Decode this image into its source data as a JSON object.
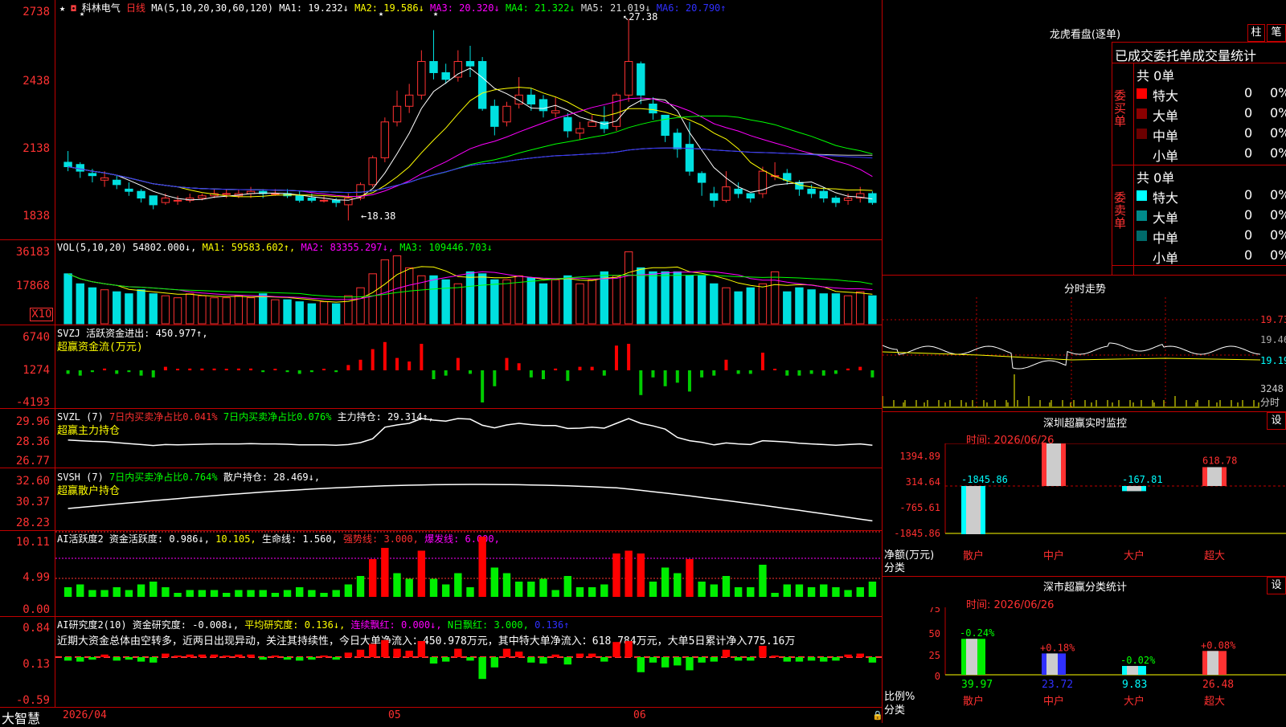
{
  "header": {
    "title": "科林电气",
    "period": "日线",
    "ma_title": "MA(5,10,20,30,60,120)",
    "ma": [
      {
        "label": "MA1: 19.232↓",
        "color": "#ffffff"
      },
      {
        "label": "MA2: 19.586↓",
        "color": "#ffff00"
      },
      {
        "label": "MA3: 20.320↓",
        "color": "#ff00ff"
      },
      {
        "label": "MA4: 21.322↓",
        "color": "#00ff00"
      },
      {
        "label": "MA5: 21.019↓",
        "color": "#dddddd"
      },
      {
        "label": "MA6: 20.790↑",
        "color": "#3030ff"
      }
    ]
  },
  "price_axis": [
    "2738",
    "2438",
    "2138",
    "1838"
  ],
  "price_annotations": {
    "high": "27.38",
    "low": "←18.38"
  },
  "vol": {
    "title": "VOL(5,10,20)",
    "value": "54802.000↓,",
    "ma": [
      {
        "label": "MA1: 59583.602↑,",
        "color": "#ffff00"
      },
      {
        "label": "MA2: 83355.297↓,",
        "color": "#ff00ff"
      },
      {
        "label": "MA3: 109446.703↓",
        "color": "#00ff00"
      }
    ],
    "axis": [
      "36183",
      "17868"
    ],
    "unit": "X10"
  },
  "svzj": {
    "title": "SVZJ  活跃资金进出: 450.977↑,",
    "subtitle": "超赢资金流(万元)",
    "axis": [
      "6740",
      "1274",
      "-4193"
    ]
  },
  "svzl": {
    "title": "SVZL (7)",
    "part1": "7日内买卖净占比0.041%",
    "part2": "7日内买卖净占比0.076%",
    "part3": "主力持仓: 29.314↑,",
    "subtitle": "超赢主力持仓",
    "axis": [
      "29.96",
      "28.36",
      "26.77"
    ]
  },
  "svsh": {
    "title": "SVSH (7)",
    "part1": "7日内买卖净占比0.764%",
    "part2": "散户持仓: 28.469↓,",
    "subtitle": "超赢散户持仓",
    "axis": [
      "32.60",
      "30.37",
      "28.23"
    ]
  },
  "ai1": {
    "title": "AI活跃度2 资金活跃度: 0.986↓,",
    "p1": "10.105,",
    "p2": "生命线: 1.560,",
    "p3": "强势线: 3.000,",
    "p4": "爆发线: 6.000,",
    "axis": [
      "10.11",
      "4.99",
      "0.00"
    ]
  },
  "ai2": {
    "title": "AI研究度2(10) 资金研究度: -0.008↓,",
    "p1": "平均研究度: 0.136↓,",
    "p2": "连续飘红: 0.000↓,",
    "p3": "N日飘红: 3.000,",
    "p4": "0.136↑",
    "text": "近期大资金总体由空转多，近两日出现异动，关注其持续性，今日大单净流入：450.978万元，其中特大单净流入：618.784万元，大单5日累计净入775.16万",
    "axis": [
      "0.84",
      "0.13",
      "-0.59"
    ]
  },
  "bottom": {
    "brand": "大智慧",
    "date_start": "2026/04",
    "m1": "05",
    "m2": "06"
  },
  "right": {
    "lhb_title": "龙虎看盘(逐单)",
    "btn_zhu": "柱",
    "btn_bi": "笔",
    "tabs_title": "已成交委托单成交量统计",
    "buy": {
      "label": "委买单",
      "total": "共 0单",
      "rows": [
        {
          "name": "特大",
          "v": "0",
          "p": "0%",
          "color": "#ff0000"
        },
        {
          "name": "大单",
          "v": "0",
          "p": "0%",
          "color": "#8b0000"
        },
        {
          "name": "中单",
          "v": "0",
          "p": "0%",
          "color": "#6b0000"
        },
        {
          "name": "小单",
          "v": "0",
          "p": "0%",
          "color": "#000000"
        }
      ]
    },
    "sell": {
      "label": "委卖单",
      "total": "共 0单",
      "rows": [
        {
          "name": "特大",
          "v": "0",
          "p": "0%",
          "color": "#00ffff"
        },
        {
          "name": "大单",
          "v": "0",
          "p": "0%",
          "color": "#008b8b"
        },
        {
          "name": "中单",
          "v": "0",
          "p": "0%",
          "color": "#006b6b"
        },
        {
          "name": "小单",
          "v": "0",
          "p": "0%",
          "color": "#000000"
        }
      ]
    },
    "intraday_title": "分时走势",
    "intraday_axis": [
      "19.73",
      "19.46",
      "19.19",
      "3248",
      "分时"
    ],
    "sz_title": "深圳超赢实时监控",
    "sz_btn": "设",
    "sz_time": "时间: 2026/06/26",
    "sz_axis": [
      "1394.89",
      "314.64",
      "-765.61",
      "-1845.86"
    ],
    "sz_ylabel": "净额(万元)",
    "sz_xlabel": "分类",
    "sz_values": [
      "-1845.86",
      "1394.89",
      "-167.81",
      "618.78"
    ],
    "cats": [
      "散户",
      "中户",
      "大户",
      "超大"
    ],
    "ss_title": "深市超赢分类统计",
    "ss_btn": "设",
    "ss_time": "时间: 2026/06/26",
    "ss_axis": [
      "75",
      "50",
      "25",
      "0"
    ],
    "ss_ylabel": "比例%",
    "ss_xlabel": "分类",
    "ss_top": [
      "-0.24%",
      "+0.18%",
      "-0.02%",
      "+0.08%"
    ],
    "ss_bottom": [
      "39.97",
      "23.72",
      "9.83",
      "26.48"
    ]
  },
  "chart_data": {
    "type": "candlestick",
    "price_range": [
      18.2,
      27.6
    ],
    "candles": [
      [
        21.0,
        20.8,
        21.5,
        20.6
      ],
      [
        20.9,
        20.6,
        21.0,
        20.3
      ],
      [
        20.5,
        20.4,
        20.7,
        20.1
      ],
      [
        20.2,
        20.3,
        20.6,
        19.9
      ],
      [
        20.2,
        20.0,
        20.4,
        19.8
      ],
      [
        19.8,
        19.7,
        20.1,
        19.5
      ],
      [
        19.7,
        19.4,
        19.8,
        19.2
      ],
      [
        19.5,
        19.1,
        19.5,
        18.9
      ],
      [
        19.2,
        19.4,
        19.6,
        19.1
      ],
      [
        19.3,
        19.3,
        19.5,
        19.1
      ],
      [
        19.3,
        19.4,
        19.6,
        19.2
      ],
      [
        19.4,
        19.5,
        19.6,
        19.3
      ],
      [
        19.5,
        19.6,
        19.8,
        19.4
      ],
      [
        19.6,
        19.6,
        19.8,
        19.4
      ],
      [
        19.5,
        19.6,
        19.8,
        19.4
      ],
      [
        19.6,
        19.7,
        19.9,
        19.4
      ],
      [
        19.7,
        19.6,
        19.8,
        19.4
      ],
      [
        19.6,
        19.6,
        19.8,
        19.5
      ],
      [
        19.6,
        19.5,
        19.8,
        19.4
      ],
      [
        19.5,
        19.3,
        19.7,
        19.2
      ],
      [
        19.4,
        19.3,
        19.6,
        19.2
      ],
      [
        19.3,
        19.3,
        19.5,
        19.2
      ],
      [
        19.3,
        19.2,
        19.4,
        19.0
      ],
      [
        19.1,
        19.4,
        19.6,
        18.4
      ],
      [
        19.4,
        20.0,
        20.1,
        19.3
      ],
      [
        20.0,
        21.2,
        21.3,
        19.9
      ],
      [
        21.2,
        22.8,
        23.0,
        21.0
      ],
      [
        22.8,
        23.5,
        24.2,
        22.6
      ],
      [
        23.5,
        24.0,
        24.5,
        23.2
      ],
      [
        24.0,
        25.5,
        26.0,
        23.8
      ],
      [
        25.5,
        25.0,
        26.9,
        24.7
      ],
      [
        25.0,
        24.7,
        25.4,
        24.5
      ],
      [
        24.8,
        25.5,
        26.0,
        24.6
      ],
      [
        25.5,
        25.3,
        26.2,
        24.8
      ],
      [
        25.5,
        23.4,
        25.7,
        23.3
      ],
      [
        23.5,
        22.6,
        23.8,
        22.2
      ],
      [
        22.8,
        23.5,
        23.7,
        22.6
      ],
      [
        23.6,
        24.0,
        24.8,
        23.4
      ],
      [
        24.0,
        23.6,
        24.3,
        23.3
      ],
      [
        23.8,
        23.3,
        24.0,
        23.0
      ],
      [
        23.2,
        23.3,
        23.9,
        23.0
      ],
      [
        23.0,
        22.4,
        23.2,
        22.1
      ],
      [
        22.3,
        22.5,
        22.8,
        22.0
      ],
      [
        22.6,
        22.8,
        23.1,
        22.6
      ],
      [
        22.8,
        22.5,
        23.5,
        22.3
      ],
      [
        22.6,
        24.0,
        24.1,
        22.4
      ],
      [
        24.0,
        25.5,
        27.4,
        23.7
      ],
      [
        25.4,
        24.0,
        25.5,
        23.6
      ],
      [
        23.6,
        23.2,
        23.9,
        22.9
      ],
      [
        23.1,
        22.2,
        23.1,
        21.9
      ],
      [
        22.3,
        21.6,
        22.5,
        21.2
      ],
      [
        21.8,
        20.6,
        22.8,
        20.4
      ],
      [
        20.5,
        20.1,
        20.6,
        19.5
      ],
      [
        19.6,
        19.3,
        19.9,
        19.0
      ],
      [
        19.3,
        19.9,
        20.6,
        19.2
      ],
      [
        19.8,
        19.6,
        20.1,
        19.4
      ],
      [
        19.6,
        19.4,
        19.6,
        19.2
      ],
      [
        19.6,
        20.6,
        20.8,
        19.4
      ],
      [
        20.4,
        20.4,
        21.0,
        20.2
      ],
      [
        20.5,
        20.2,
        20.7,
        20.0
      ],
      [
        20.1,
        19.8,
        20.2,
        19.5
      ],
      [
        19.8,
        19.6,
        20.0,
        19.4
      ],
      [
        19.7,
        19.4,
        19.9,
        19.2
      ],
      [
        19.4,
        19.2,
        19.5,
        19.0
      ],
      [
        19.3,
        19.4,
        19.6,
        19.1
      ],
      [
        19.4,
        19.6,
        19.9,
        19.2
      ],
      [
        19.6,
        19.2,
        19.7,
        19.1
      ]
    ],
    "volume": [
      25,
      20,
      18,
      17,
      16,
      15,
      17,
      15,
      14,
      13,
      15,
      14,
      13,
      13,
      14,
      13,
      15,
      12,
      12,
      11,
      10,
      11,
      10,
      14,
      18,
      25,
      32,
      34,
      28,
      24,
      24,
      22,
      20,
      26,
      25,
      22,
      22,
      24,
      23,
      20,
      22,
      24,
      20,
      22,
      26,
      24,
      36,
      28,
      26,
      26,
      26,
      24,
      24,
      20,
      18,
      16,
      18,
      20,
      26,
      16,
      18,
      17,
      15,
      15,
      14,
      16,
      14
    ],
    "volume_range": [
      0,
      36.18
    ]
  }
}
